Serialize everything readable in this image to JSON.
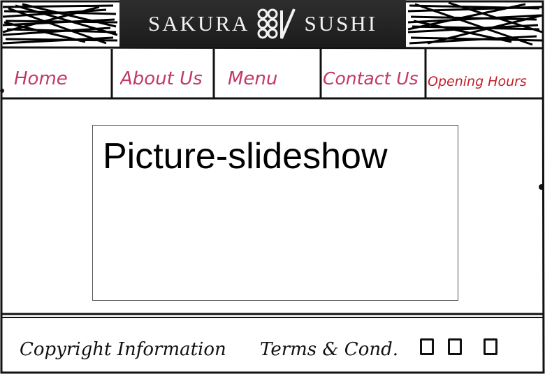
{
  "header": {
    "logo_left": "SAKURA",
    "logo_right": "SUSHI",
    "logo_icon": "sakura-logo-icon",
    "logo_bg_color": "#1f1f1f"
  },
  "nav": {
    "items": [
      {
        "label": "Home",
        "color": "#c2386a"
      },
      {
        "label": "About Us",
        "color": "#c2386a"
      },
      {
        "label": "Menu",
        "color": "#c2386a"
      },
      {
        "label": "Contact Us",
        "color": "#c2386a"
      },
      {
        "label": "Opening Hours",
        "color": "#c2202a"
      }
    ]
  },
  "main": {
    "slideshow_label": "Picture-slideshow"
  },
  "footer": {
    "copyright": "Copyright Information",
    "terms": "Terms & Cond.",
    "social_icons": [
      "social-icon",
      "social-icon",
      "social-icon"
    ]
  }
}
